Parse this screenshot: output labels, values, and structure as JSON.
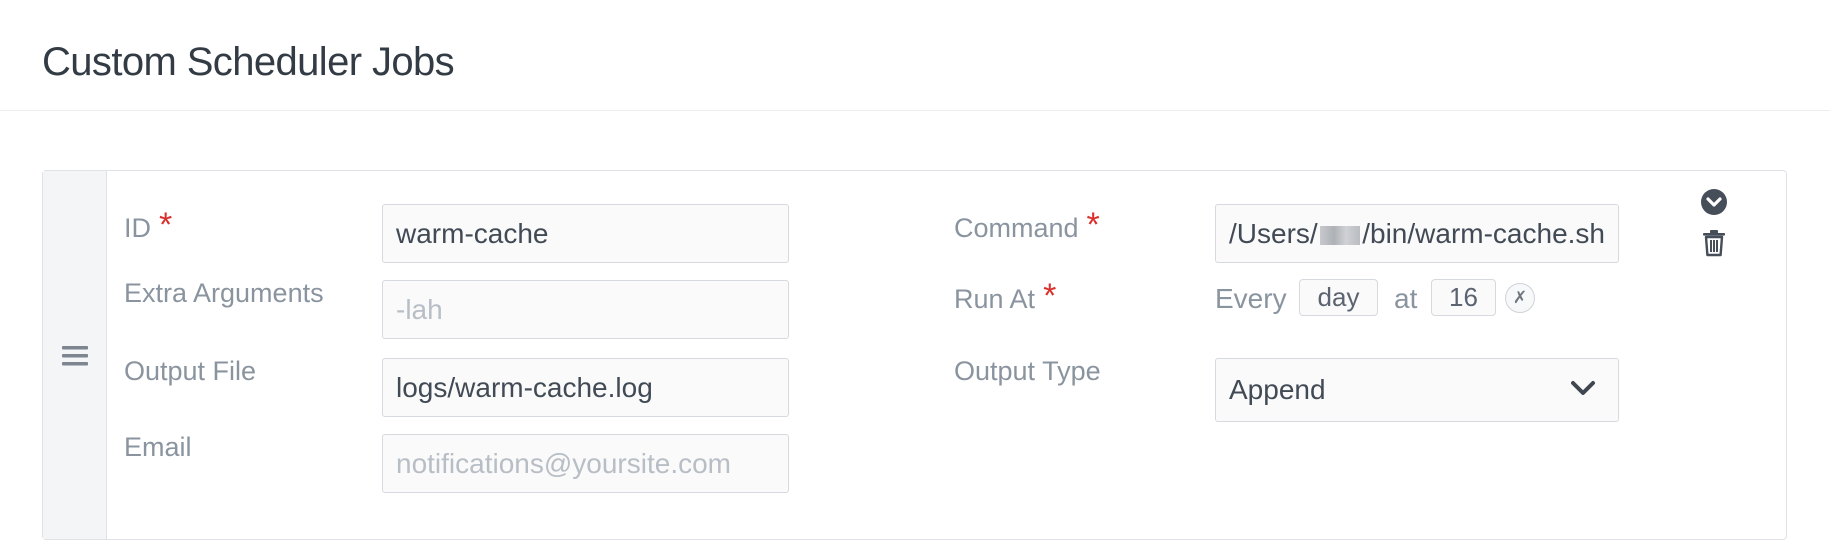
{
  "header": {
    "title": "Custom Scheduler Jobs"
  },
  "job": {
    "id": {
      "label": "ID",
      "value": "warm-cache"
    },
    "extra_arguments": {
      "label": "Extra Arguments",
      "value": "",
      "placeholder": "-lah"
    },
    "output_file": {
      "label": "Output File",
      "value": "logs/warm-cache.log"
    },
    "email": {
      "label": "Email",
      "value": "",
      "placeholder": "notifications@yoursite.com"
    },
    "command": {
      "label": "Command",
      "value_prefix": "/Users/",
      "value_suffix": "/bin/warm-cache.sh"
    },
    "run_at": {
      "label": "Run At",
      "every_text": "Every",
      "period": "day",
      "at_text": "at",
      "hour": "16",
      "clear_glyph": "✗"
    },
    "output_type": {
      "label": "Output Type",
      "selected": "Append"
    },
    "required_marker": "*"
  },
  "icons": {
    "drag_handle": "hamburger-icon",
    "expand": "chevron-circle-down-icon",
    "delete": "trash-icon",
    "select_arrow": "chevron-down-icon"
  },
  "colors": {
    "required": "#d9302c",
    "label": "#8a949f",
    "text": "#414a55",
    "border": "#d6d9dd",
    "icon": "#454e59"
  }
}
